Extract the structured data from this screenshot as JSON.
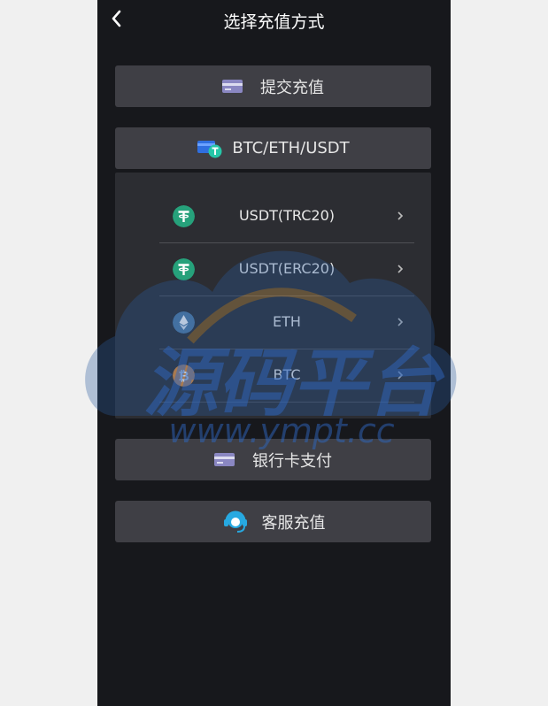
{
  "header": {
    "title": "选择充值方式",
    "back_icon": "chevron-left-icon"
  },
  "options": {
    "submit_label": "提交充值",
    "crypto_label": "BTC/ETH/USDT",
    "bank_label": "银行卡支付",
    "service_label": "客服充值"
  },
  "crypto_list": [
    {
      "label": "USDT(TRC20)",
      "icon": "tether-icon",
      "color": "#26a17b"
    },
    {
      "label": "USDT(ERC20)",
      "icon": "tether-icon",
      "color": "#26a17b"
    },
    {
      "label": "ETH",
      "icon": "ethereum-icon",
      "color": "#4f7aa3"
    },
    {
      "label": "BTC",
      "icon": "bitcoin-icon",
      "color": "#e8892a"
    }
  ],
  "watermark": {
    "title": "源码平台",
    "url": "www.ympt.cc"
  },
  "colors": {
    "background": "#17181c",
    "button": "#3f3f45",
    "panel": "#2c2d32",
    "accent_blue": "#27a9e1"
  }
}
